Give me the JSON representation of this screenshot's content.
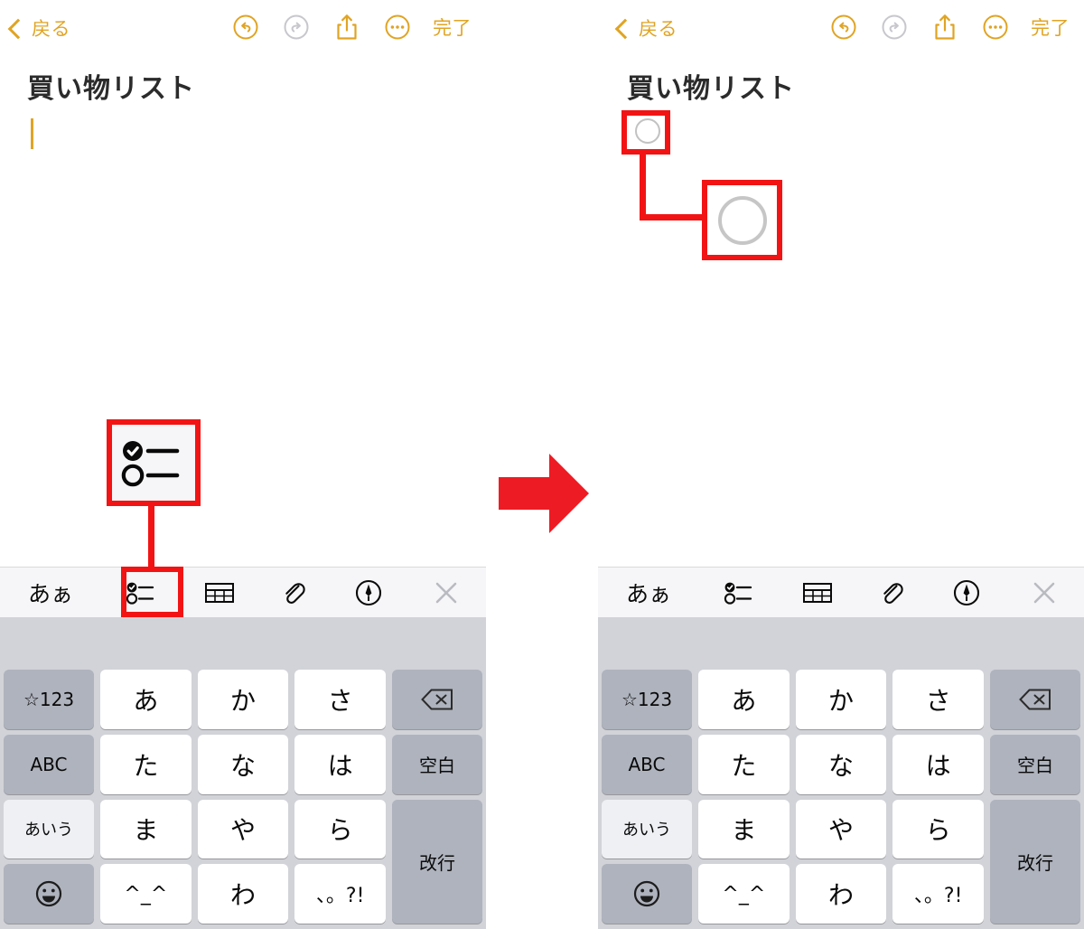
{
  "navbar": {
    "back_label": "戻る",
    "done_label": "完了",
    "icons": {
      "back_chevron": "chevron-left-icon",
      "undo": "undo-icon",
      "redo": "redo-icon",
      "share": "share-icon",
      "more": "more-ellipsis-icon"
    },
    "undo_enabled": true,
    "redo_enabled": false,
    "accent_color": "#E0A424",
    "disabled_color": "#C7C7CC"
  },
  "note": {
    "title": "買い物リスト",
    "left_body_state": "empty-cursor",
    "right_body_state": "checklist-item-empty"
  },
  "toolbar": {
    "items": [
      {
        "name": "text-format-button",
        "label": "あぁ"
      },
      {
        "name": "checklist-button",
        "label": ""
      },
      {
        "name": "table-button",
        "label": ""
      },
      {
        "name": "attachment-button",
        "label": ""
      },
      {
        "name": "markup-button",
        "label": ""
      },
      {
        "name": "close-keyboard-button",
        "label": ""
      }
    ],
    "background": "#F6F6F8"
  },
  "keyboard": {
    "type": "japanese-kana-12key",
    "rows": [
      [
        {
          "label": "☆123",
          "style": "fn"
        },
        {
          "label": "あ",
          "style": "char"
        },
        {
          "label": "か",
          "style": "char"
        },
        {
          "label": "さ",
          "style": "char"
        },
        {
          "label": "",
          "style": "fn",
          "icon": "backspace-icon"
        }
      ],
      [
        {
          "label": "ABC",
          "style": "fn"
        },
        {
          "label": "た",
          "style": "char"
        },
        {
          "label": "な",
          "style": "char"
        },
        {
          "label": "は",
          "style": "char"
        },
        {
          "label": "空白",
          "style": "fn"
        }
      ],
      [
        {
          "label": "あいう",
          "style": "fn-light"
        },
        {
          "label": "ま",
          "style": "char"
        },
        {
          "label": "や",
          "style": "char"
        },
        {
          "label": "ら",
          "style": "char"
        },
        {
          "label": "改行",
          "style": "fn-return"
        }
      ],
      [
        {
          "label": "",
          "style": "fn",
          "icon": "emoji-icon"
        },
        {
          "label": "^_^",
          "style": "char-small"
        },
        {
          "label": "わ",
          "style": "char"
        },
        {
          "label": "、。?!",
          "style": "char-small"
        }
      ]
    ],
    "background": "#D1D3D8",
    "key_background": "#FFFFFF",
    "fn_key_background": "#AEB3BD"
  },
  "annotations": {
    "highlight_color": "#F21414",
    "arrow": {
      "name": "red-right-arrow",
      "direction": "right"
    },
    "left_callout": {
      "target": "checklist-button",
      "zoom_icon": "checklist-icon-magnified"
    },
    "right_callout": {
      "target": "note-checkbox",
      "zoom_icon": "empty-checkbox-circle-magnified"
    }
  }
}
